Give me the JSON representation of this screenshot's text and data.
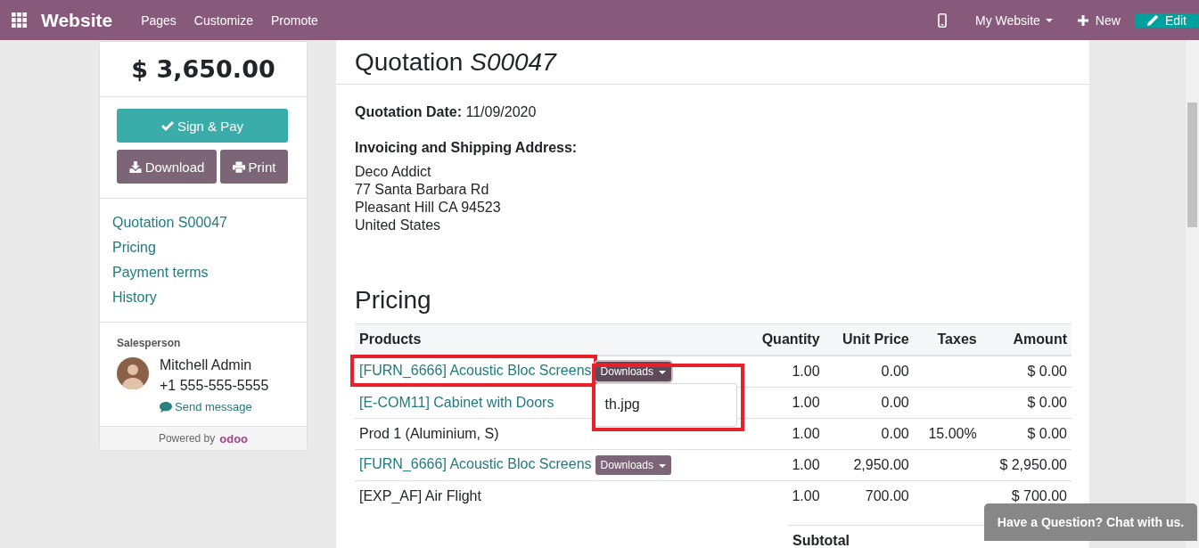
{
  "navbar": {
    "brand": "Website",
    "menu": [
      "Pages",
      "Customize",
      "Promote"
    ],
    "website_menu": "My Website",
    "new_label": "New",
    "edit_label": "Edit"
  },
  "sidebar": {
    "total": "$ 3,650.00",
    "sign_pay": "Sign & Pay",
    "download": "Download",
    "print": "Print",
    "nav": [
      "Quotation S00047",
      "Pricing",
      "Payment terms",
      "History"
    ],
    "salesperson_label": "Salesperson",
    "salesperson_name": "Mitchell Admin",
    "phone": "+1 555-555-5555",
    "send_message": "Send message",
    "powered_by": "Powered by",
    "powered_brand": "odoo"
  },
  "quotation": {
    "title": "Quotation *S00047*",
    "date_line": "**Quotation Date:** 11/09/2020",
    "address_heading": "Invoicing and Shipping Address:",
    "address": [
      "Deco Addict",
      "77 Santa Barbara Rd",
      "Pleasant Hill CA 94523",
      "United States"
    ],
    "pricing_heading": "Pricing",
    "columns": [
      "Products",
      "Quantity",
      "Unit Price",
      "Taxes",
      "Amount"
    ],
    "rows": [
      {
        "product": "[FURN_6666] Acoustic Bloc Screens",
        "link": true,
        "highlighted": true,
        "downloads": "Downloads",
        "downloads_open": true,
        "quantity": "1.00",
        "unit_price": "0.00",
        "amount": "$ 0.00"
      },
      {
        "product": "[E-COM11] Cabinet with Doors",
        "link": true,
        "highlighted": false,
        "quantity": "1.00",
        "unit_price": "0.00",
        "amount": "$ 0.00"
      },
      {
        "product": "Prod 1 (Aluminium, S)",
        "link": false,
        "highlighted": false,
        "quantity": "1.00",
        "unit_price": "0.00",
        "taxes": "15.00%",
        "amount": "$ 0.00"
      },
      {
        "product": "[FURN_6666] Acoustic Bloc Screens",
        "link": true,
        "highlighted": false,
        "downloads": "Downloads",
        "downloads_open": false,
        "quantity": "1.00",
        "unit_price": "2,950.00",
        "amount": "$ 2,950.00"
      },
      {
        "product": "[EXP_AF] Air Flight",
        "link": false,
        "highlighted": false,
        "quantity": "1.00",
        "unit_price": "700.00",
        "amount": "$ 700.00"
      }
    ],
    "dropdown": {
      "items": [
        "th.jpg"
      ],
      "highlighted": true
    },
    "subtotal_label": "Subtotal"
  },
  "chat_button": "Have a Question? Chat with us."
}
